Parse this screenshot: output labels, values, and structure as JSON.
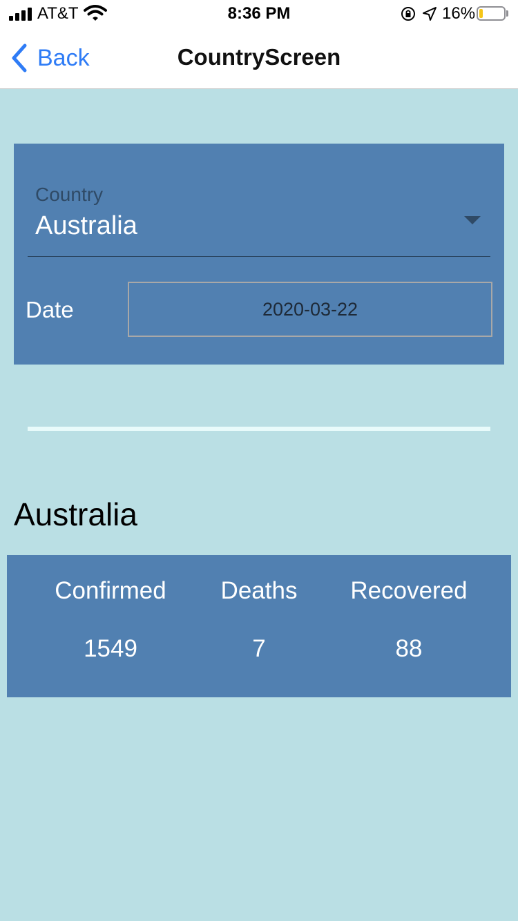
{
  "status_bar": {
    "carrier": "AT&T",
    "time": "8:36 PM",
    "battery_percent": "16%",
    "battery_level": 0.16,
    "icons": [
      "signal-icon",
      "wifi-icon",
      "orientation-lock-icon",
      "location-icon",
      "battery-icon"
    ]
  },
  "nav": {
    "back_label": "Back",
    "title": "CountryScreen",
    "accent_color": "#2f7cf6"
  },
  "form": {
    "country_label": "Country",
    "country_value": "Australia",
    "date_label": "Date",
    "date_value": "2020-03-22"
  },
  "result": {
    "country": "Australia",
    "columns": [
      {
        "label": "Confirmed",
        "value": "1549"
      },
      {
        "label": "Deaths",
        "value": "7"
      },
      {
        "label": "Recovered",
        "value": "88"
      }
    ]
  },
  "colors": {
    "background": "#badfe4",
    "card": "#5180b1",
    "divider": "#e9fbfb"
  }
}
